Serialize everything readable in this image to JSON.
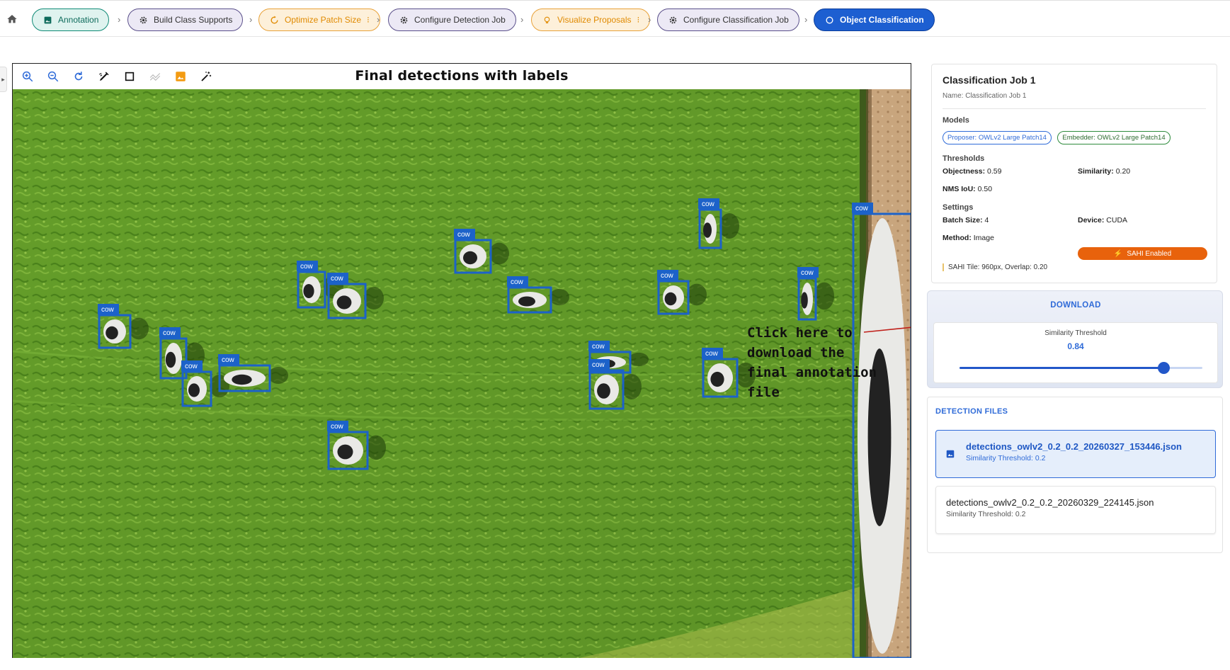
{
  "workflow": {
    "steps": [
      {
        "label": "Annotation",
        "icon": "image-icon"
      },
      {
        "label": "Build Class Supports",
        "icon": "gear-icon"
      },
      {
        "label": "Optimize Patch Size",
        "icon": "sync-icon"
      },
      {
        "label": "Configure Detection Job",
        "icon": "gear-icon"
      },
      {
        "label": "Visualize Proposals",
        "icon": "bulb-icon"
      },
      {
        "label": "Configure Classification Job",
        "icon": "gear-icon"
      },
      {
        "label": "Object Classification",
        "icon": "circle-icon"
      }
    ],
    "colors": {
      "done": "#0f8a76",
      "progress": "#e8a23a",
      "default": "#5a4f8a",
      "active": "#1d5fd1"
    }
  },
  "viewer": {
    "title": "Final detections with labels",
    "tools": [
      "zoom-in-icon",
      "zoom-out-icon",
      "reset-icon",
      "draw-icon",
      "box-icon",
      "line-icon",
      "image-icon",
      "magic-wand-icon"
    ],
    "detection_label": "cow",
    "annotation_text": [
      "Click here to",
      "download the",
      "final annotation",
      "file"
    ]
  },
  "job": {
    "title": "Classification Job 1",
    "name_line": "Name: Classification Job 1",
    "models_heading": "Models",
    "proposer_chip": "Proposer: OWLv2 Large Patch14",
    "embedder_chip": "Embedder: OWLv2 Large Patch14",
    "thresholds_heading": "Thresholds",
    "objectness_key": "Objectness:",
    "objectness_val": "0.59",
    "similarity_key": "Similarity:",
    "similarity_val": "0.20",
    "nms_key": "NMS IoU:",
    "nms_val": "0.50",
    "settings_heading": "Settings",
    "batch_key": "Batch Size:",
    "batch_val": "4",
    "device_key": "Device:",
    "device_val": "CUDA",
    "method_key": "Method:",
    "method_val": "Image",
    "sahi_badge": "SAHI Enabled",
    "sahi_note": "SAHI Tile: 960px, Overlap: 0.20"
  },
  "download": {
    "button_label": "DOWNLOAD",
    "slider_label": "Similarity Threshold",
    "slider_value": "0.84",
    "slider_fraction": 0.84
  },
  "files": {
    "heading": "DETECTION FILES",
    "items": [
      {
        "name": "detections_owlv2_0.2_0.2_20260327_153446.json",
        "sub": "Similarity Threshold: 0.2"
      },
      {
        "name": "detections_owlv2_0.2_0.2_20260329_224145.json",
        "sub": "Similarity Threshold: 0.2"
      }
    ]
  }
}
